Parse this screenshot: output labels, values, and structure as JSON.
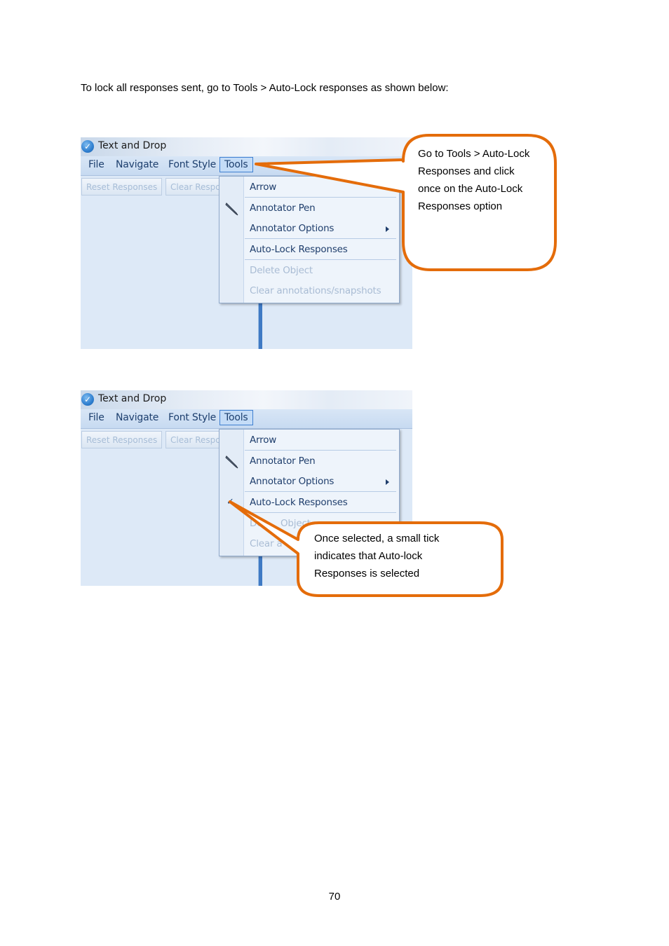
{
  "intro_text": "To lock all responses sent, go to Tools > Auto-Lock responses as shown below:",
  "app": {
    "title": "Text and Drop",
    "menu": [
      "File",
      "Navigate",
      "Font Style",
      "Tools"
    ],
    "toolbar": [
      "Reset Responses",
      "Clear Respo"
    ]
  },
  "tools_menu": {
    "items": [
      {
        "label": "Arrow",
        "enabled": true
      },
      {
        "label": "Annotator Pen",
        "enabled": true,
        "icon": "pen-icon"
      },
      {
        "label": "Annotator Options",
        "enabled": true,
        "submenu": true
      },
      {
        "label": "Auto-Lock Responses",
        "enabled": true
      },
      {
        "label": "Delete Object",
        "enabled": false
      },
      {
        "label": "Clear annotations/snapshots",
        "enabled": false
      }
    ]
  },
  "screenshot2_partial": {
    "delete_fragment_1": "De",
    "delete_fragment_2": "Object",
    "clear_fragment": "Clear a"
  },
  "callout1": {
    "lines": [
      "Go to Tools > Auto-Lock",
      "Responses and click",
      "once on the Auto-Lock",
      "Responses option"
    ]
  },
  "callout2": {
    "lines": [
      "Once selected, a small tick",
      "indicates that Auto-lock",
      "Responses is selected"
    ]
  },
  "colors": {
    "callout_border": "#e46c0a",
    "app_background": "#dde9f7",
    "menu_text": "#1f3e6c"
  },
  "page_number": "70"
}
